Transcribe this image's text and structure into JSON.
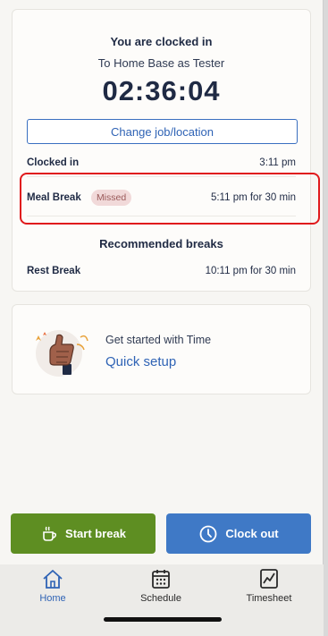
{
  "status": {
    "title": "You are clocked in",
    "subtitle": "To Home Base as Tester",
    "timer": "02:36:04",
    "change_button": "Change job/location",
    "clocked_in_label": "Clocked in",
    "clocked_in_time": "3:11 pm",
    "meal_break_label": "Meal Break",
    "meal_break_badge": "Missed",
    "meal_break_time": "5:11 pm for 30 min",
    "recommended_title": "Recommended breaks",
    "rest_break_label": "Rest Break",
    "rest_break_time": "10:11 pm for 30 min"
  },
  "setup": {
    "text": "Get started with Time",
    "link": "Quick setup"
  },
  "actions": {
    "start_break": "Start break",
    "clock_out": "Clock out"
  },
  "tabs": [
    {
      "label": "Home",
      "icon": "home-icon",
      "active": true
    },
    {
      "label": "Schedule",
      "icon": "calendar-icon"
    },
    {
      "label": "Timesheet",
      "icon": "chart-icon"
    }
  ],
  "colors": {
    "primary_blue": "#3f79c6",
    "break_green": "#5e8e22",
    "missed_badge_bg": "#f1d9d9",
    "highlight_red": "#e0191c"
  }
}
